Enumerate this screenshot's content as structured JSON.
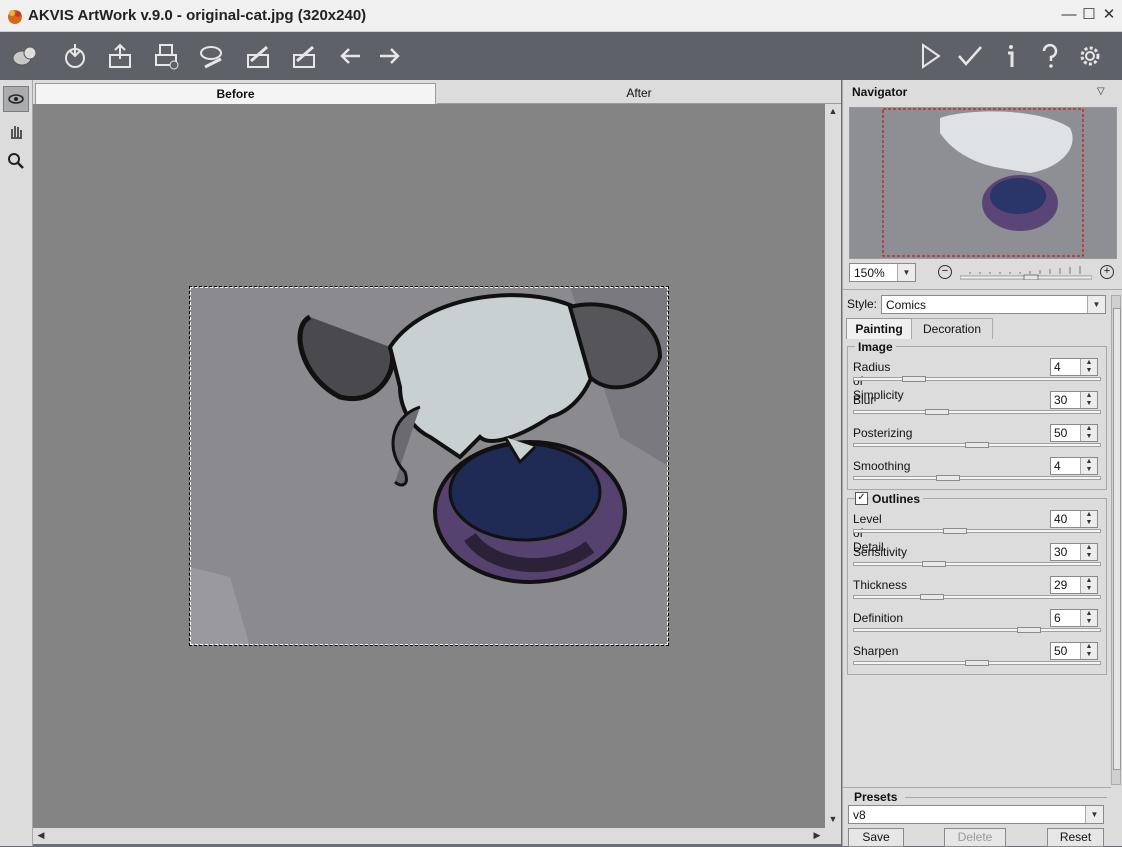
{
  "window": {
    "title": "AKVIS ArtWork v.9.0 - original-cat.jpg (320x240)",
    "minimize_glyph": "—",
    "maximize_glyph": "☐",
    "close_glyph": "✕"
  },
  "toolbar": {
    "left_icons": [
      "logo-icon",
      "open-icon",
      "save-icon",
      "print-icon",
      "brush-load-icon",
      "strokes-load-icon",
      "strokes-save-icon",
      "undo-icon",
      "redo-icon"
    ],
    "right_icons": [
      "run-icon",
      "apply-icon",
      "info-icon",
      "help-icon",
      "settings-icon"
    ]
  },
  "tools": [
    "before-after-icon",
    "hand-icon",
    "zoom-icon"
  ],
  "tabs": {
    "before": "Before",
    "after": "After"
  },
  "navigator": {
    "title": "Navigator",
    "zoom": "150%"
  },
  "style": {
    "label": "Style:",
    "value": "Comics"
  },
  "subtabs": {
    "painting": "Painting",
    "decoration": "Decoration"
  },
  "image_group": {
    "title": "Image",
    "params": [
      {
        "label": "Radius of Simplicity",
        "value": "4",
        "level": 0.22
      },
      {
        "label": "Blur",
        "value": "30",
        "level": 0.32
      },
      {
        "label": "Posterizing",
        "value": "50",
        "level": 0.5
      },
      {
        "label": "Smoothing",
        "value": "4",
        "level": 0.37
      }
    ]
  },
  "outlines_group": {
    "title": "Outlines",
    "checked": true,
    "params": [
      {
        "label": "Level of Detail",
        "value": "40",
        "level": 0.4
      },
      {
        "label": "Sensitivity",
        "value": "30",
        "level": 0.31
      },
      {
        "label": "Thickness",
        "value": "29",
        "level": 0.3
      },
      {
        "label": "Definition",
        "value": "6",
        "level": 0.73
      },
      {
        "label": "Sharpen",
        "value": "50",
        "level": 0.5
      }
    ]
  },
  "presets": {
    "title": "Presets",
    "value": "v8",
    "save": "Save",
    "delete": "Delete",
    "reset": "Reset"
  },
  "colors": {
    "toolbar": "#5e6168",
    "panel": "#dcdcdc",
    "canvas": "#848484"
  }
}
